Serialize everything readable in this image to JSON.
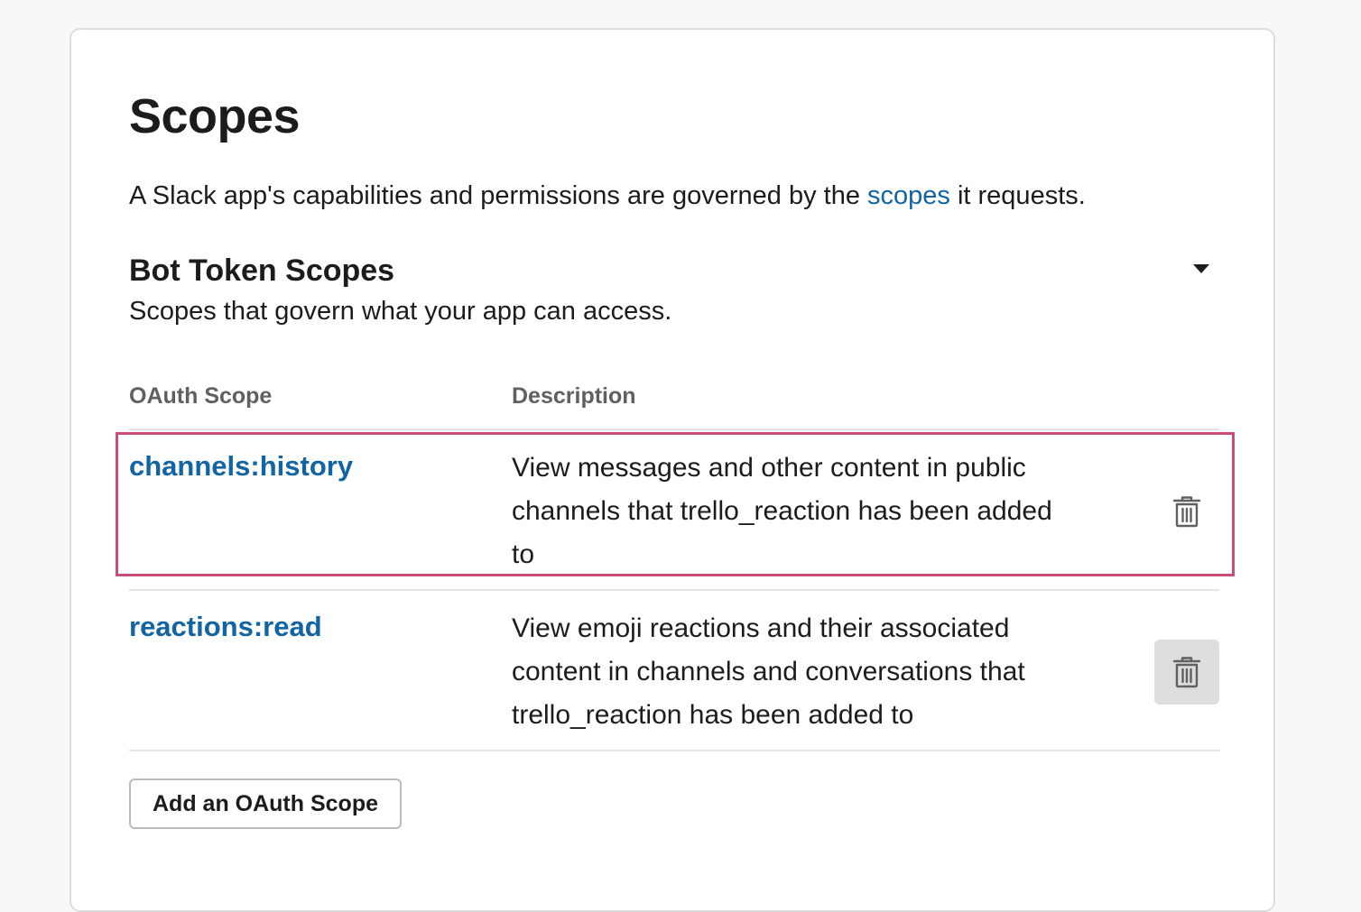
{
  "page": {
    "title": "Scopes",
    "intro_before_link": "A Slack app's capabilities and permissions are governed by the ",
    "intro_link": "scopes",
    "intro_after_link": " it requests."
  },
  "bot_token_scopes": {
    "title": "Bot Token Scopes",
    "subtitle": "Scopes that govern what your app can access.",
    "toggle_icon": "caret-down-icon",
    "columns": {
      "scope": "OAuth Scope",
      "description": "Description"
    },
    "rows": [
      {
        "scope": "channels:history",
        "description": "View messages and other content in public channels that trello_reaction has been added to",
        "delete_icon": "trash-icon"
      },
      {
        "scope": "reactions:read",
        "description": "View emoji reactions and their associated content in channels and conversations that trello_reaction has been added to",
        "delete_icon": "trash-icon"
      }
    ],
    "add_button_label": "Add an OAuth Scope"
  },
  "colors": {
    "link": "#1264a3",
    "highlight_border": "#c94c7c",
    "text": "#1d1c1d",
    "muted": "#616061"
  }
}
